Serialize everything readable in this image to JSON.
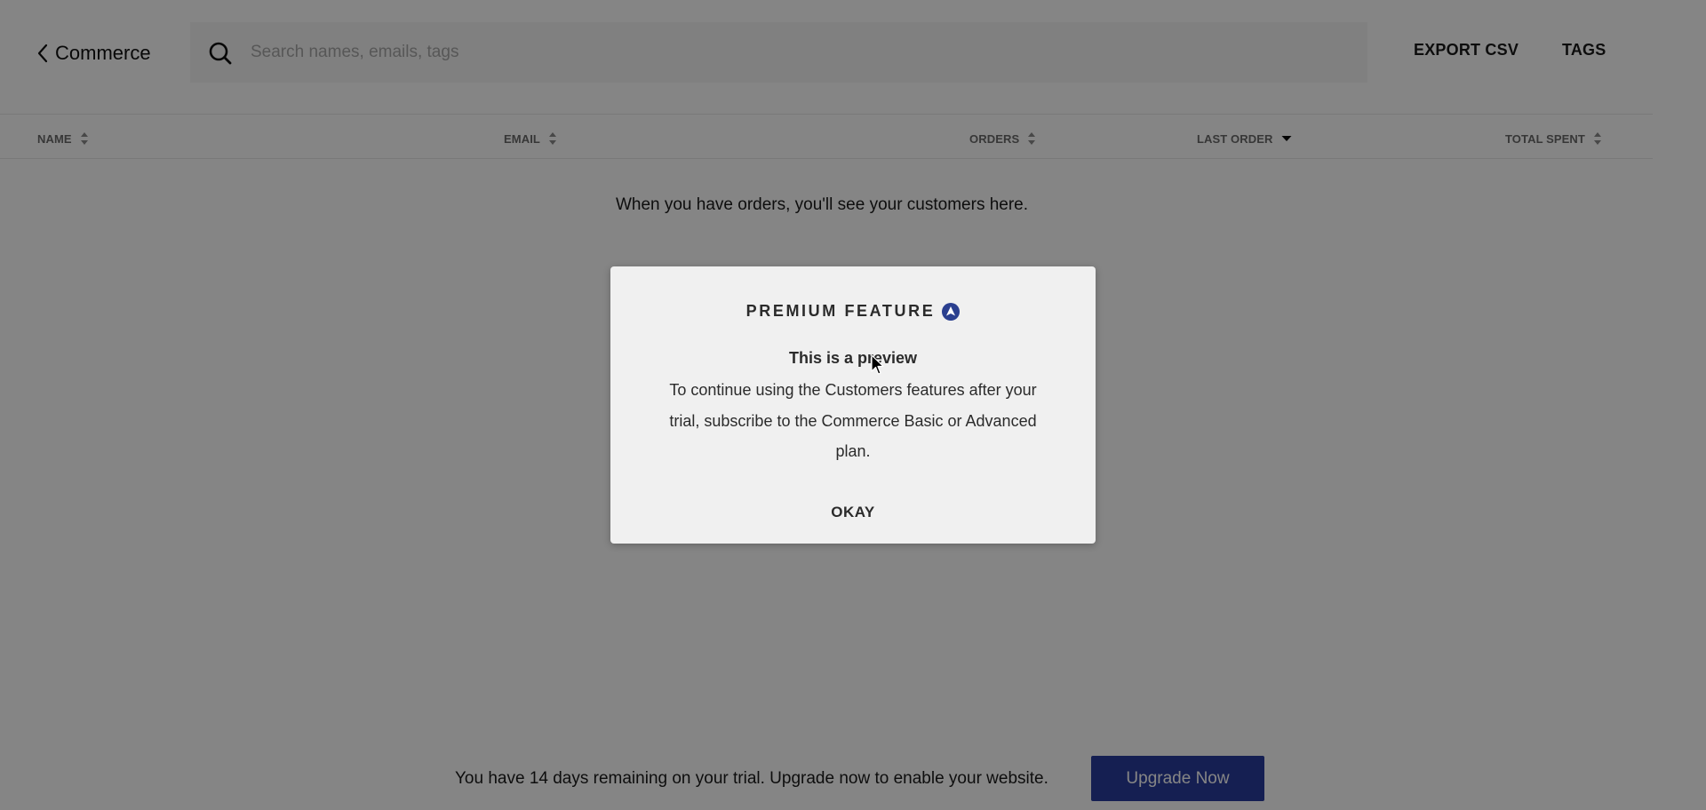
{
  "header": {
    "back_label": "Commerce",
    "search": {
      "placeholder": "Search names, emails, tags",
      "value": ""
    },
    "actions": {
      "export_csv": "EXPORT CSV",
      "tags": "TAGS"
    }
  },
  "table": {
    "columns": [
      {
        "label": "NAME",
        "sort": "none"
      },
      {
        "label": "EMAIL",
        "sort": "none"
      },
      {
        "label": "ORDERS",
        "sort": "none"
      },
      {
        "label": "LAST ORDER",
        "sort": "descending"
      },
      {
        "label": "TOTAL SPENT",
        "sort": "none"
      }
    ],
    "rows": [],
    "empty_message": "When you have orders, you'll see your customers here."
  },
  "modal": {
    "title": "PREMIUM FEATURE",
    "icon": "premium-arrow-icon",
    "subtitle": "This is a preview",
    "body": "To continue using the Customers features after your trial, subscribe to the Commerce Basic or Advanced plan.",
    "okay_label": "OKAY"
  },
  "trial_banner": {
    "message": "You have 14 days remaining on your trial. Upgrade now to enable your website.",
    "days_remaining": 14,
    "button_label": "Upgrade Now"
  },
  "colors": {
    "accent": "#2a3d9e",
    "premium_icon": "#2a3f8f",
    "overlay": "rgba(0,0,0,0.48)",
    "modal_background": "#f0f0f0"
  }
}
